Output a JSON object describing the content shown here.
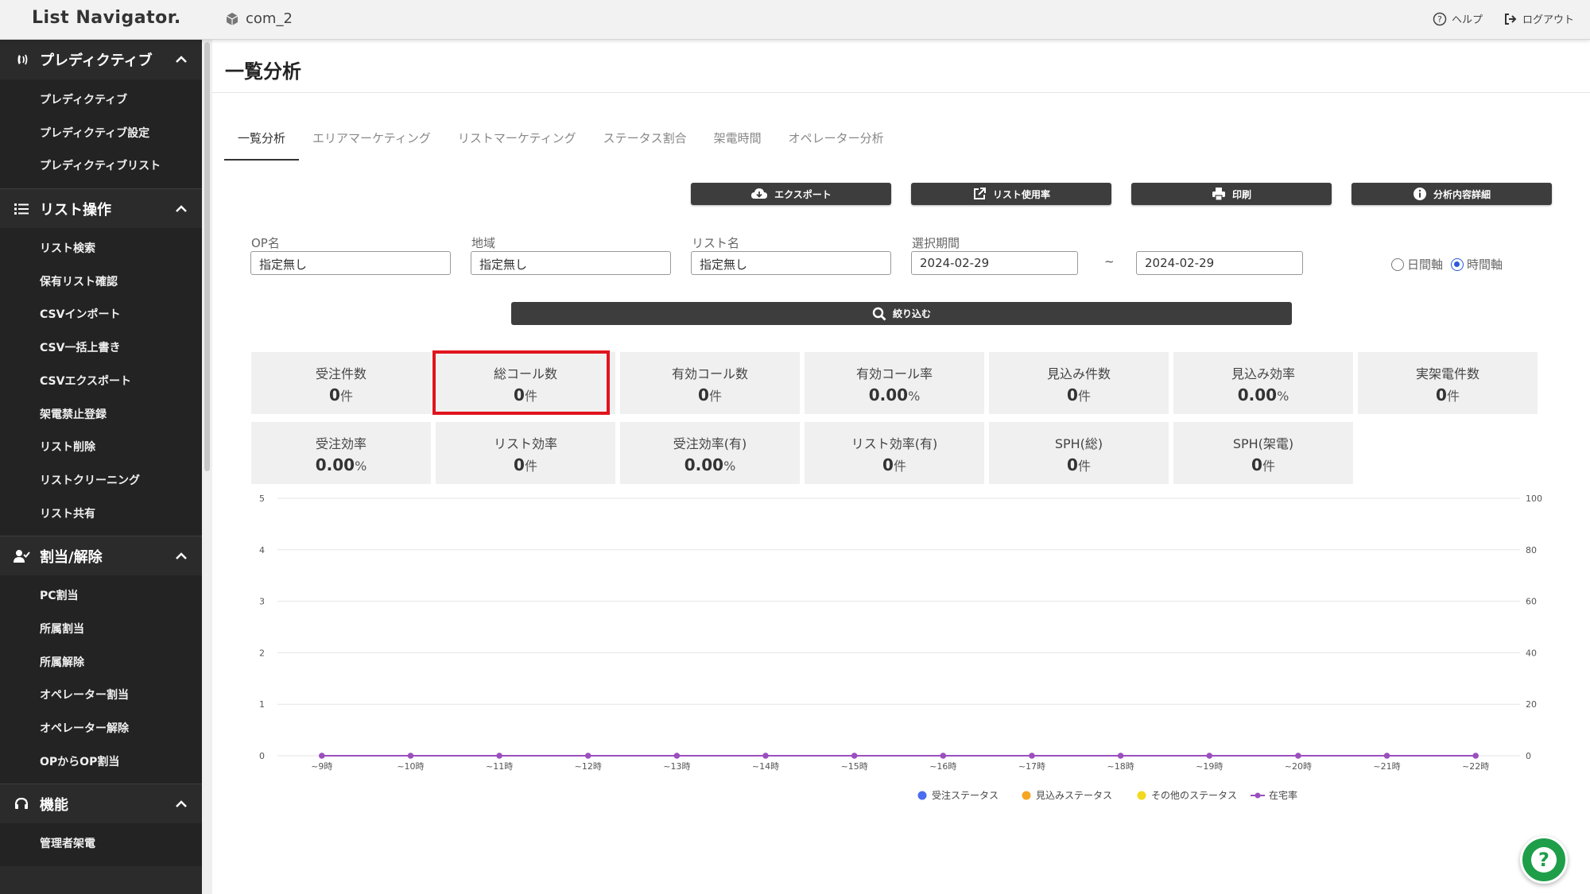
{
  "app": {
    "logo": "List Navigator.",
    "company": "com_2"
  },
  "top_actions": {
    "help": "ヘルプ",
    "logout": "ログアウト"
  },
  "sidebar": {
    "sections": [
      {
        "label": "プレディクティブ",
        "icon": "phone-signal-icon",
        "items": [
          "プレディクティブ",
          "プレディクティブ設定",
          "プレディクティブリスト"
        ]
      },
      {
        "label": "リスト操作",
        "icon": "list-icon",
        "items": [
          "リスト検索",
          "保有リスト確認",
          "CSVインポート",
          "CSV一括上書き",
          "CSVエクスポート",
          "架電禁止登録",
          "リスト削除",
          "リストクリーニング",
          "リスト共有"
        ]
      },
      {
        "label": "割当/解除",
        "icon": "user-check-icon",
        "items": [
          "PC割当",
          "所属割当",
          "所属解除",
          "オペレーター割当",
          "オペレーター解除",
          "OPからOP割当"
        ]
      },
      {
        "label": "機能",
        "icon": "headset-icon",
        "items": [
          "管理者架電"
        ]
      }
    ]
  },
  "page": {
    "title": "一覧分析"
  },
  "tabs": [
    "一覧分析",
    "エリアマーケティング",
    "リストマーケティング",
    "ステータス割合",
    "架電時間",
    "オペレーター分析"
  ],
  "actions": {
    "export": "エクスポート",
    "list_usage": "リスト使用率",
    "print": "印刷",
    "details": "分析内容詳細"
  },
  "filters": {
    "op_label": "OP名",
    "op_value": "指定無し",
    "area_label": "地域",
    "area_value": "指定無し",
    "list_label": "リスト名",
    "list_value": "指定無し",
    "period_label": "選択期間",
    "period_from": "2024-02-29",
    "period_tilde": "~",
    "period_to": "2024-02-29",
    "axis_day": "日間軸",
    "axis_hour": "時間軸",
    "submit": "絞り込む"
  },
  "stats": [
    {
      "label": "受注件数",
      "value": "0",
      "unit": "件"
    },
    {
      "label": "総コール数",
      "value": "0",
      "unit": "件"
    },
    {
      "label": "有効コール数",
      "value": "0",
      "unit": "件"
    },
    {
      "label": "有効コール率",
      "value": "0.00",
      "unit": "%"
    },
    {
      "label": "見込み件数",
      "value": "0",
      "unit": "件"
    },
    {
      "label": "見込み効率",
      "value": "0.00",
      "unit": "%"
    },
    {
      "label": "実架電件数",
      "value": "0",
      "unit": "件"
    },
    {
      "label": "受注効率",
      "value": "0.00",
      "unit": "%"
    },
    {
      "label": "リスト効率",
      "value": "0",
      "unit": "件"
    },
    {
      "label": "受注効率(有)",
      "value": "0.00",
      "unit": "%"
    },
    {
      "label": "リスト効率(有)",
      "value": "0",
      "unit": "件"
    },
    {
      "label": "SPH(総)",
      "value": "0",
      "unit": "件"
    },
    {
      "label": "SPH(架電)",
      "value": "0",
      "unit": "件"
    }
  ],
  "colors": {
    "order": "#4a6cf0",
    "prospect": "#f5a623",
    "other": "#f2d91d",
    "presence": "#9b4fbf",
    "fab": "#1f9e4a",
    "highlight": "#e0141e"
  },
  "chart_data": {
    "type": "line",
    "x": [
      "~9時",
      "~10時",
      "~11時",
      "~12時",
      "~13時",
      "~14時",
      "~15時",
      "~16時",
      "~17時",
      "~18時",
      "~19時",
      "~20時",
      "~21時",
      "~22時"
    ],
    "ylim": [
      0,
      5
    ],
    "y_ticks": [
      "0",
      "1",
      "2",
      "3",
      "4",
      "5"
    ],
    "y2lim": [
      0,
      100
    ],
    "y2_ticks": [
      "0",
      "20",
      "40",
      "60",
      "80",
      "100"
    ],
    "grid": true,
    "legend": "bottom",
    "series": [
      {
        "name": "受注ステータス",
        "values": [
          0,
          0,
          0,
          0,
          0,
          0,
          0,
          0,
          0,
          0,
          0,
          0,
          0,
          0
        ]
      },
      {
        "name": "見込みステータス",
        "values": [
          0,
          0,
          0,
          0,
          0,
          0,
          0,
          0,
          0,
          0,
          0,
          0,
          0,
          0
        ]
      },
      {
        "name": "その他のステータス",
        "values": [
          0,
          0,
          0,
          0,
          0,
          0,
          0,
          0,
          0,
          0,
          0,
          0,
          0,
          0
        ]
      },
      {
        "name": "在宅率",
        "values": [
          0,
          0,
          0,
          0,
          0,
          0,
          0,
          0,
          0,
          0,
          0,
          0,
          0,
          0
        ]
      }
    ]
  }
}
